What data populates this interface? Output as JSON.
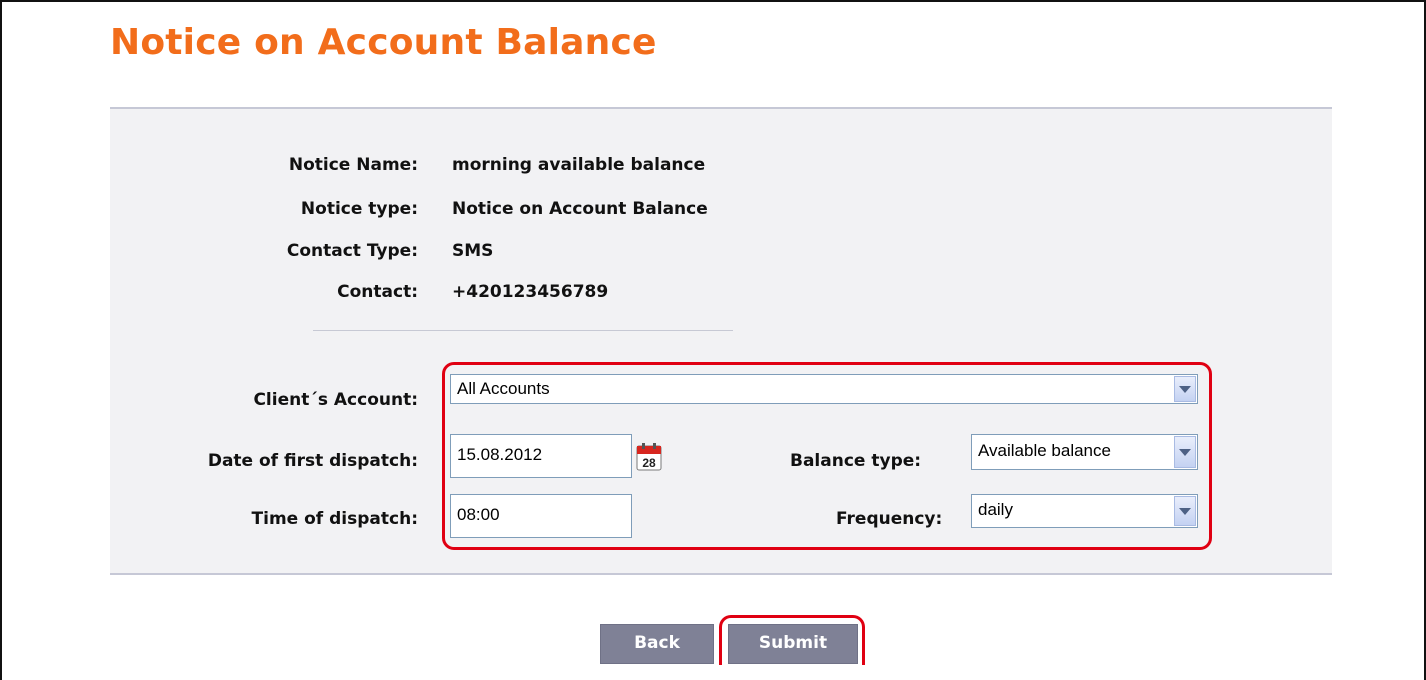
{
  "page": {
    "title": "Notice on Account Balance"
  },
  "details": [
    {
      "label": "Notice Name:",
      "value": "morning available balance"
    },
    {
      "label": "Notice type:",
      "value": "Notice on Account Balance"
    },
    {
      "label": "Contact Type:",
      "value": "SMS"
    },
    {
      "label": "Contact:",
      "value": "+420123456789"
    }
  ],
  "form": {
    "client_account_label": "Client´s Account:",
    "client_account_value": "All Accounts",
    "date_label": "Date of first dispatch:",
    "date_value": "15.08.2012",
    "calendar_day": "28",
    "balance_type_label": "Balance type:",
    "balance_type_value": "Available balance",
    "time_label": "Time of dispatch:",
    "time_value": "08:00",
    "frequency_label": "Frequency:",
    "frequency_value": "daily"
  },
  "buttons": {
    "back_label": "Back",
    "submit_label": "Submit"
  },
  "colors": {
    "title": "#f26d1b",
    "highlight": "#e00012",
    "button": "#7f8196",
    "panel": "#f2f2f4"
  },
  "icons": {
    "calendar": "calendar-icon",
    "dropdown": "chevron-down-icon"
  }
}
